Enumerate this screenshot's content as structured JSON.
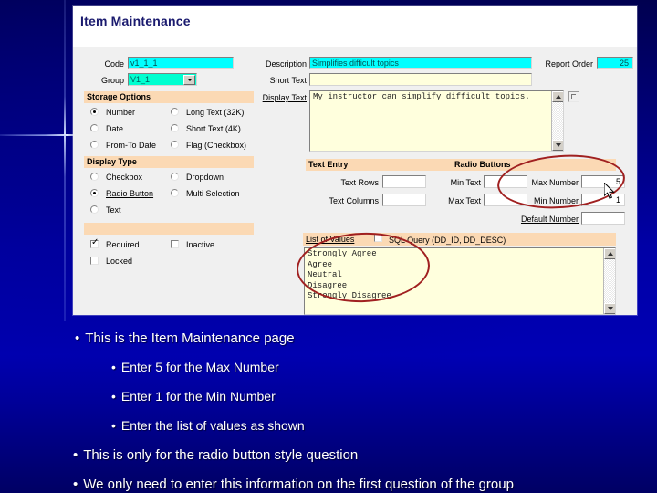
{
  "slide": {
    "background_color": "#0000a6",
    "text_color": "#ffffff"
  },
  "screenshot": {
    "title": "Item Maintenance",
    "left_column": {
      "code": {
        "label": "Code",
        "value": "v1_1_1"
      },
      "group": {
        "label": "Group",
        "value": "V1_1"
      },
      "storage_options": {
        "header": "Storage Options",
        "options": [
          {
            "label": "Number",
            "selected": true
          },
          {
            "label": "Date",
            "selected": false
          },
          {
            "label": "From-To Date",
            "selected": false
          },
          {
            "label": "Long Text (32K)",
            "selected": false
          },
          {
            "label": "Short Text (4K)",
            "selected": false
          },
          {
            "label": "Flag (Checkbox)",
            "selected": false
          }
        ]
      },
      "display_type": {
        "header": "Display Type",
        "options": [
          {
            "label": "Checkbox",
            "selected": false
          },
          {
            "label": "Radio Button",
            "selected": true
          },
          {
            "label": "Text",
            "selected": false
          },
          {
            "label": "Dropdown",
            "selected": false
          },
          {
            "label": "Multi Selection",
            "selected": false
          }
        ]
      },
      "flags": [
        {
          "label": "Required",
          "checked": true
        },
        {
          "label": "Inactive",
          "checked": false
        },
        {
          "label": "Locked",
          "checked": false
        }
      ]
    },
    "right_column": {
      "description": {
        "label": "Description",
        "value": "Simplifies difficult topics"
      },
      "report_order": {
        "label": "Report Order",
        "value": "25"
      },
      "short_text": {
        "label": "Short Text",
        "value": ""
      },
      "display_text": {
        "label": "Display Text",
        "value": "My instructor can simplify difficult topics."
      },
      "text_entry": {
        "header": "Text Entry",
        "fields": [
          {
            "label": "Text Rows",
            "value": ""
          },
          {
            "label": "Text Columns",
            "value": ""
          },
          {
            "label": "Min Text",
            "value": ""
          },
          {
            "label": "Max Text",
            "value": ""
          }
        ]
      },
      "radio_buttons": {
        "header": "Radio Buttons",
        "fields": [
          {
            "label": "Max Number",
            "value": "5"
          },
          {
            "label": "Min Number",
            "value": "1"
          },
          {
            "label": "Default Number",
            "value": ""
          }
        ]
      },
      "list_of_values": {
        "header": "List of Values",
        "sql_query_label": "SQL Query (DD_ID, DD_DESC)",
        "sql_query_checked": false,
        "values": [
          "Strongly Agree",
          "Agree",
          "Neutral",
          "Disagree",
          "Strongly Disagree"
        ],
        "text": "Strongly Agree\nAgree\nNeutral\nDisagree\nStrongly Disagree"
      }
    },
    "annotations": {
      "color": "#a02020",
      "shapes": [
        {
          "name": "ellipse-max-min-number"
        },
        {
          "name": "ellipse-list-of-values"
        }
      ]
    }
  },
  "bullets": [
    {
      "level": 1,
      "text": "This is the Item Maintenance page"
    },
    {
      "level": 2,
      "text": "Enter 5 for the Max Number"
    },
    {
      "level": 2,
      "text": "Enter 1 for the Min Number"
    },
    {
      "level": 2,
      "text": "Enter the list of values as shown"
    },
    {
      "level": 1,
      "text": "This is only for the radio button style question"
    },
    {
      "level": 1,
      "text": "We only need to enter this information on the first question of the group"
    }
  ]
}
